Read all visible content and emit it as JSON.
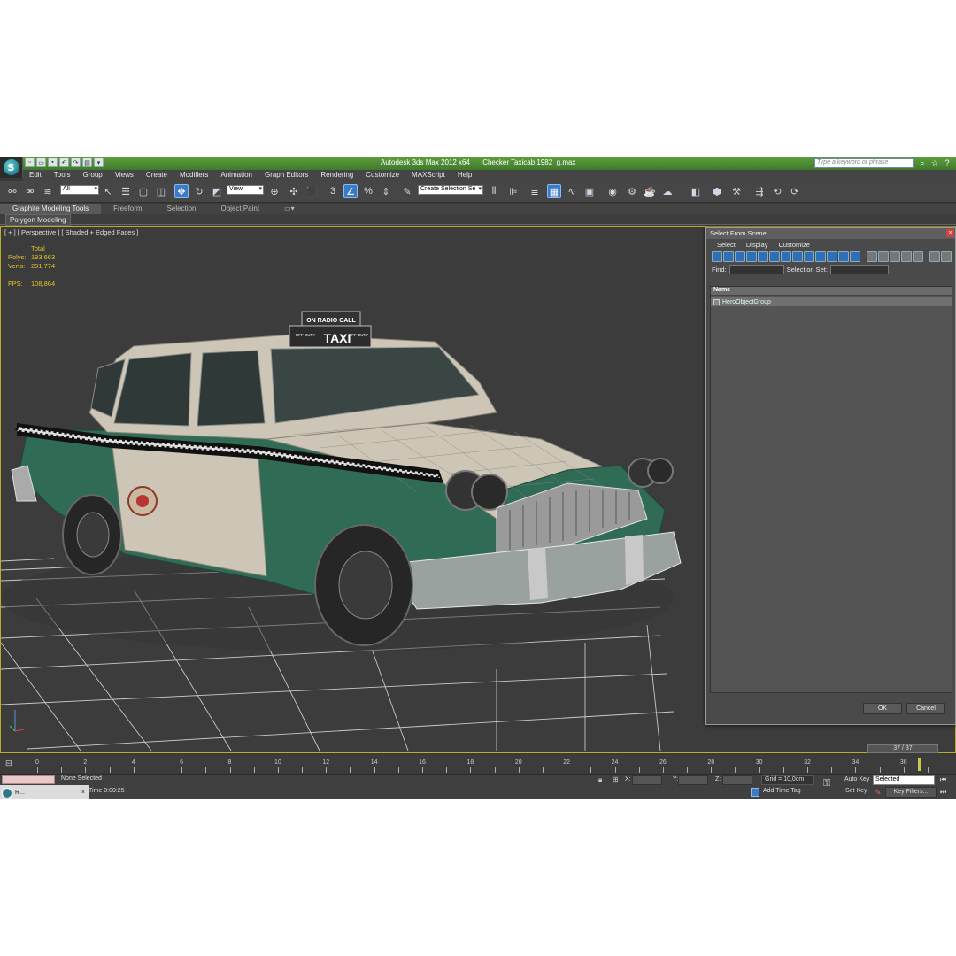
{
  "title_bar": {
    "app_name": "Autodesk 3ds Max  2012 x64",
    "file_name": "Checker Taxicab 1982_g.max",
    "search_placeholder": "Type a keyword or phrase"
  },
  "menu": [
    "Edit",
    "Tools",
    "Group",
    "Views",
    "Create",
    "Modifiers",
    "Animation",
    "Graph Editors",
    "Rendering",
    "Customize",
    "MAXScript",
    "Help"
  ],
  "toolbar": {
    "selection_filter": "All",
    "ref_coord": "View",
    "named_selection": "Create Selection Se"
  },
  "ribbon": {
    "tabs": [
      "Graphite Modeling Tools",
      "Freeform",
      "Selection",
      "Object Paint"
    ],
    "active_tab": "Graphite Modeling Tools",
    "panel": "Polygon Modeling"
  },
  "viewport": {
    "label": "[ + ] [ Perspective ] [ Shaded + Edged Faces ]",
    "stats": {
      "total_label": "Total",
      "polys_label": "Polys:",
      "polys": "193 663",
      "verts_label": "Verts:",
      "verts": "201 774",
      "fps_label": "FPS:",
      "fps": "108,864"
    },
    "taxi_sign": {
      "top": "ON RADIO CALL",
      "main": "TAXI",
      "left": "OFF DUTY",
      "right": "OFF DUTY"
    }
  },
  "dialog": {
    "title": "Select From Scene",
    "menu": [
      "Select",
      "Display",
      "Customize"
    ],
    "find_label": "Find:",
    "selection_set_label": "Selection Set:",
    "column_header": "Name",
    "items": [
      "HeroObjectGroup"
    ],
    "ok": "OK",
    "cancel": "Cancel"
  },
  "timeline": {
    "frame_counter": "37 / 37",
    "ticks": [
      "0",
      "2",
      "4",
      "6",
      "8",
      "10",
      "12",
      "14",
      "16",
      "18",
      "20",
      "22",
      "24",
      "26",
      "28",
      "30",
      "32",
      "34",
      "36"
    ]
  },
  "status": {
    "selection": "None Selected",
    "time": "Time  0:00:25",
    "x_label": "X:",
    "y_label": "Y:",
    "z_label": "Z:",
    "grid": "Grid = 10,0cm",
    "add_time_tag": "Add Time Tag",
    "auto_key": "Auto Key",
    "set_key": "Set Key",
    "key_mode": "Selected",
    "key_filters": "Key Filters...",
    "taskbar_label": "R..."
  },
  "colors": {
    "title_green": "#4f8c35",
    "viewport_bg": "#3c3c3c",
    "stats_yellow": "#e6c32c",
    "taxi_green": "#2f6b55",
    "taxi_cream": "#cdc6b6"
  }
}
